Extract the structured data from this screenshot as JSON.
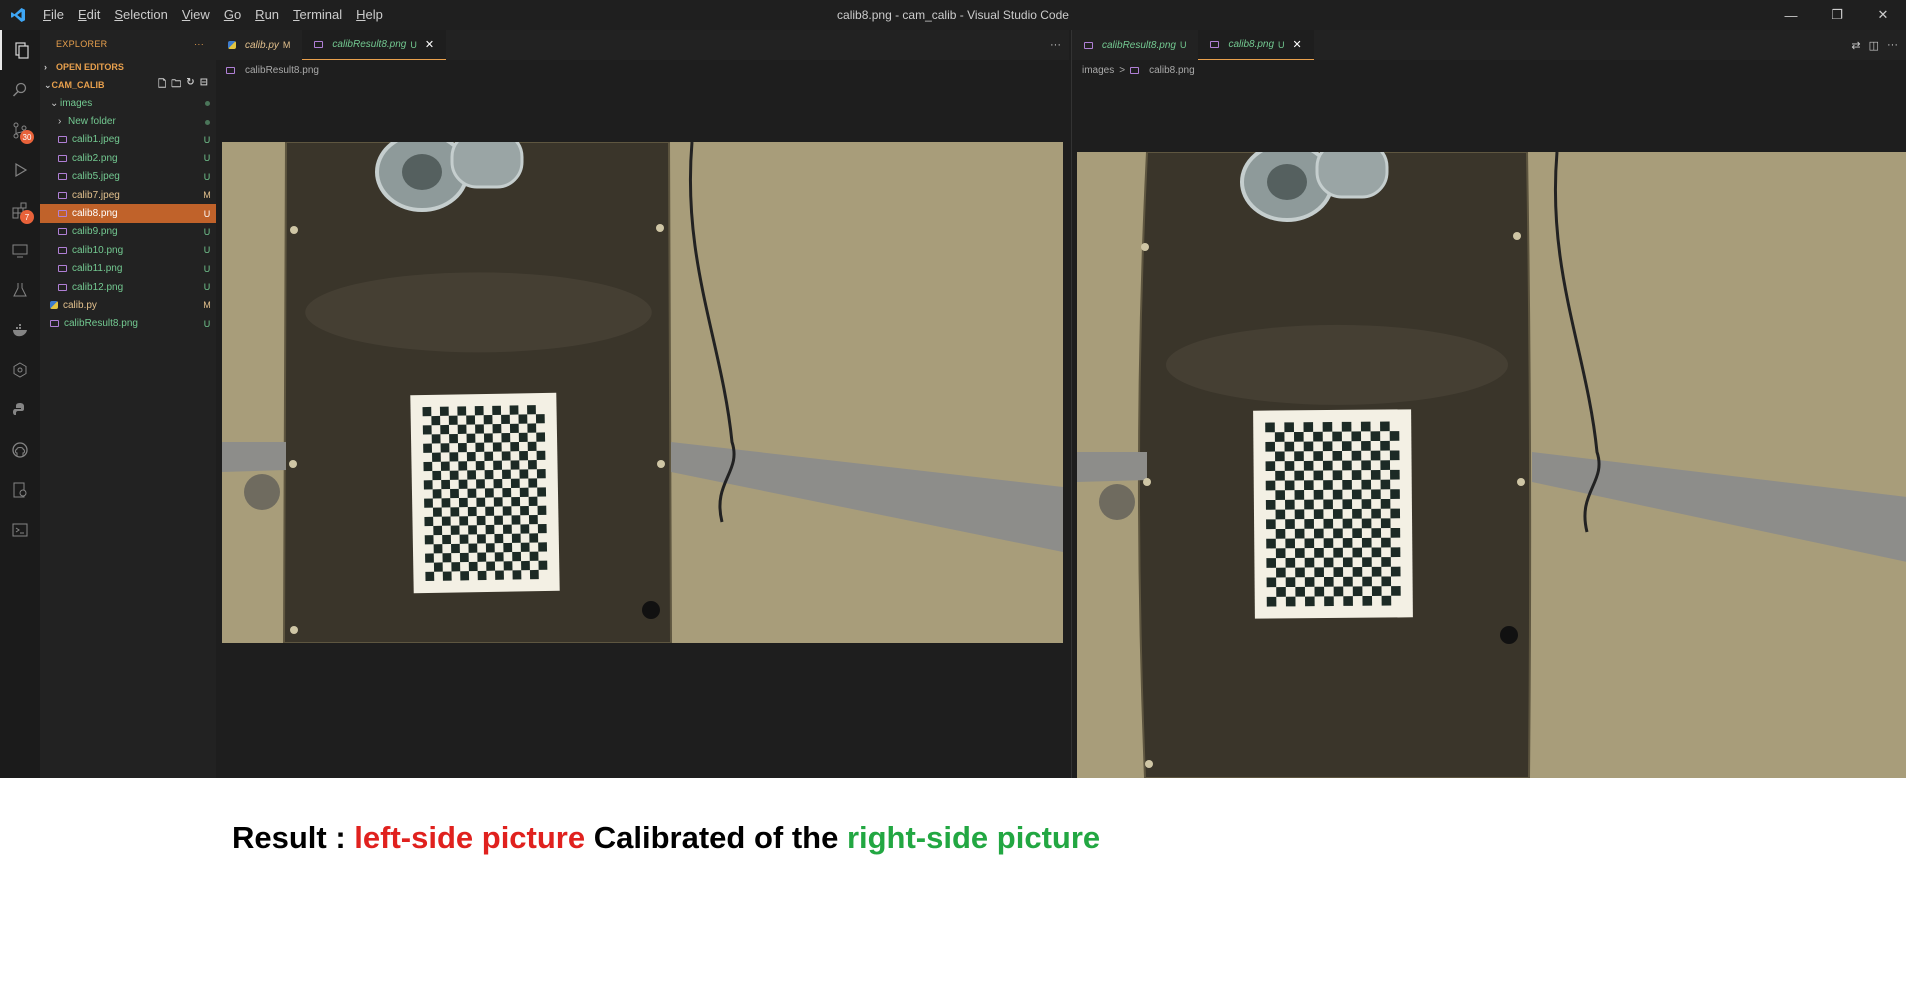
{
  "titlebar": {
    "menu": [
      "File",
      "Edit",
      "Selection",
      "View",
      "Go",
      "Run",
      "Terminal",
      "Help"
    ],
    "menu_keys": [
      "F",
      "E",
      "S",
      "V",
      "G",
      "R",
      "T",
      "H"
    ],
    "window_title": "calib8.png - cam_calib - Visual Studio Code",
    "controls": {
      "minimize": "—",
      "restore": "❐",
      "close": "✕"
    }
  },
  "activity_bar": {
    "icons": [
      "explorer-icon",
      "search-icon",
      "source-control-icon",
      "run-debug-icon",
      "extensions-icon",
      "remote-explorer-icon",
      "testing-icon",
      "docker-icon",
      "kubernetes-icon",
      "python-icon",
      "github-icon",
      "settings-sync-icon",
      "terminal-icon"
    ],
    "source_control_badge": "30",
    "extensions_badge": "7"
  },
  "sidebar": {
    "header": "EXPLORER",
    "header_more": "···",
    "open_editors": "OPEN EDITORS",
    "project": "CAM_CALIB",
    "tree": [
      {
        "label": "images",
        "type": "folder",
        "indent": 1,
        "status": "",
        "expanded": true,
        "color": "green"
      },
      {
        "label": "New folder",
        "type": "folder",
        "indent": 2,
        "status": "",
        "expanded": false,
        "color": "green"
      },
      {
        "label": "calib1.jpeg",
        "type": "image",
        "indent": 2,
        "status": "U",
        "color": "green"
      },
      {
        "label": "calib2.png",
        "type": "image",
        "indent": 2,
        "status": "U",
        "color": "green"
      },
      {
        "label": "calib5.jpeg",
        "type": "image",
        "indent": 2,
        "status": "U",
        "color": "green"
      },
      {
        "label": "calib7.jpeg",
        "type": "image",
        "indent": 2,
        "status": "M",
        "color": "orange"
      },
      {
        "label": "calib8.png",
        "type": "image",
        "indent": 2,
        "status": "U",
        "color": "white",
        "selected": true
      },
      {
        "label": "calib9.png",
        "type": "image",
        "indent": 2,
        "status": "U",
        "color": "green"
      },
      {
        "label": "calib10.png",
        "type": "image",
        "indent": 2,
        "status": "U",
        "color": "green"
      },
      {
        "label": "calib11.png",
        "type": "image",
        "indent": 2,
        "status": "U",
        "color": "green"
      },
      {
        "label": "calib12.png",
        "type": "image",
        "indent": 2,
        "status": "U",
        "color": "green"
      },
      {
        "label": "calib.py",
        "type": "python",
        "indent": 1,
        "status": "M",
        "color": "orange"
      },
      {
        "label": "calibResult8.png",
        "type": "image",
        "indent": 1,
        "status": "U",
        "color": "green"
      }
    ]
  },
  "left_group": {
    "tabs": [
      {
        "label": "calib.py",
        "mark": "M",
        "active": false
      },
      {
        "label": "calibResult8.png",
        "mark": "U",
        "active": true,
        "close": "✕"
      }
    ],
    "breadcrumb": [
      "calibResult8.png"
    ],
    "more": "···"
  },
  "right_group": {
    "tabs": [
      {
        "label": "calibResult8.png",
        "mark": "U",
        "active": false
      },
      {
        "label": "calib8.png",
        "mark": "U",
        "active": true,
        "close": "✕"
      }
    ],
    "breadcrumb": [
      "images",
      "calib8.png"
    ],
    "breadcrumb_sep": ">",
    "more": "···"
  },
  "caption": {
    "prefix": "Result : ",
    "left": "left-side picture",
    "middle": " Calibrated of the  ",
    "right": "right-side picture"
  },
  "colors": {
    "accent": "#e8a04d",
    "git_untracked": "#73c991",
    "git_modified": "#e2c08d",
    "selection": "#c0622a",
    "caption_red": "#e0211e",
    "caption_green": "#22a742"
  }
}
